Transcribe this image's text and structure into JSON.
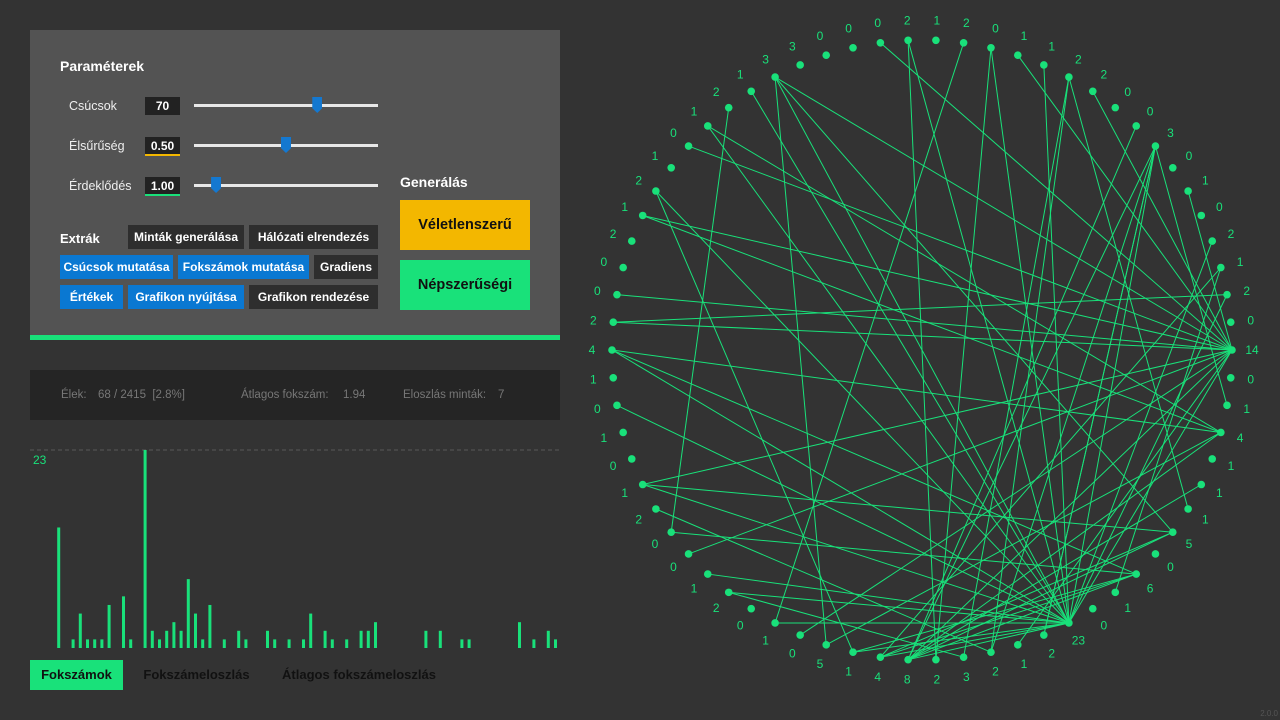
{
  "params": {
    "title": "Paraméterek",
    "sliders": [
      {
        "label": "Csúcsok",
        "value_text": "70",
        "fraction": 0.67
      },
      {
        "label": "Élsűrűség",
        "value_text": "0.50",
        "fraction": 0.5
      },
      {
        "label": "Érdeklődés",
        "value_text": "1.00",
        "fraction": 0.12
      }
    ]
  },
  "extras": {
    "label": "Extrák",
    "buttons": [
      {
        "label": "Minták generálása",
        "active": false
      },
      {
        "label": "Hálózati elrendezés",
        "active": false
      },
      {
        "label": "Csúcsok mutatása",
        "active": true
      },
      {
        "label": "Fokszámok mutatása",
        "active": true
      },
      {
        "label": "Gradiens",
        "active": false
      },
      {
        "label": "Értékek",
        "active": true
      },
      {
        "label": "Grafikon nyújtása",
        "active": true
      },
      {
        "label": "Grafikon rendezése",
        "active": false
      }
    ]
  },
  "generate": {
    "title": "Generálás",
    "random_label": "Véletlenszerű",
    "popular_label": "Népszerűségi",
    "random_color": "#f3b700",
    "popular_color": "#19e17a"
  },
  "stats": {
    "edges_label": "Élek:",
    "edges_value": "68 / 2415  [2.8%]",
    "avg_label": "Átlagos fokszám:",
    "avg_value": "1.94",
    "dist_label": "Eloszlás minták:",
    "dist_value": "7"
  },
  "chart_data": {
    "type": "bar",
    "max_label": "23",
    "ylim": [
      0,
      23
    ],
    "values": [
      0,
      14,
      0,
      1,
      4,
      1,
      1,
      1,
      5,
      0,
      6,
      1,
      0,
      23,
      2,
      1,
      2,
      3,
      2,
      8,
      4,
      1,
      5,
      0,
      1,
      0,
      2,
      1,
      0,
      0,
      2,
      1,
      0,
      1,
      0,
      1,
      4,
      0,
      2,
      1,
      0,
      1,
      0,
      2,
      2,
      3,
      0,
      0,
      0,
      0,
      0,
      0,
      2,
      0,
      2,
      0,
      0,
      1,
      1,
      0,
      0,
      0,
      0,
      0,
      0,
      3,
      0,
      1,
      0,
      2,
      1,
      2,
      0,
      2
    ]
  },
  "tabs": [
    {
      "label": "Fokszámok",
      "active": true
    },
    {
      "label": "Fokszámeloszlás",
      "active": false
    },
    {
      "label": "Átlagos fokszámeloszlás",
      "active": false
    }
  ],
  "graph": {
    "node_color": "#19e17a",
    "degrees": [
      14,
      0,
      1,
      4,
      1,
      1,
      1,
      5,
      0,
      6,
      1,
      0,
      23,
      2,
      1,
      2,
      3,
      2,
      8,
      4,
      1,
      5,
      0,
      1,
      0,
      2,
      1,
      0,
      0,
      2,
      1,
      0,
      1,
      0,
      1,
      4,
      2,
      0,
      0,
      2,
      1,
      2,
      1,
      0,
      1,
      2,
      1,
      3,
      3,
      0,
      0,
      0,
      2,
      1,
      2,
      0,
      1,
      1,
      2,
      2,
      0,
      0,
      3,
      0,
      1,
      0,
      2,
      1,
      2,
      0
    ],
    "edges": [
      [
        0,
        36
      ],
      [
        0,
        37
      ],
      [
        0,
        40
      ],
      [
        0,
        51
      ],
      [
        0,
        56
      ],
      [
        0,
        59
      ],
      [
        0,
        47
      ],
      [
        0,
        30
      ],
      [
        0,
        27
      ],
      [
        0,
        22
      ],
      [
        0,
        18
      ],
      [
        0,
        14
      ],
      [
        0,
        12
      ],
      [
        0,
        64
      ],
      [
        12,
        26
      ],
      [
        12,
        25
      ],
      [
        12,
        23
      ],
      [
        12,
        20
      ],
      [
        12,
        19
      ],
      [
        12,
        18
      ],
      [
        12,
        41
      ],
      [
        12,
        44
      ],
      [
        12,
        46
      ],
      [
        12,
        47
      ],
      [
        12,
        52
      ],
      [
        12,
        55
      ],
      [
        12,
        57
      ],
      [
        12,
        62
      ],
      [
        12,
        66
      ],
      [
        12,
        68
      ],
      [
        12,
        35
      ],
      [
        12,
        33
      ],
      [
        12,
        30
      ],
      [
        3,
        35
      ],
      [
        3,
        40
      ],
      [
        3,
        44
      ],
      [
        3,
        18
      ],
      [
        3,
        21
      ],
      [
        7,
        18
      ],
      [
        7,
        19
      ],
      [
        7,
        47
      ],
      [
        7,
        30
      ],
      [
        9,
        18
      ],
      [
        9,
        19
      ],
      [
        9,
        35
      ],
      [
        9,
        20
      ],
      [
        9,
        28
      ],
      [
        13,
        62
      ],
      [
        13,
        62
      ],
      [
        15,
        62
      ],
      [
        15,
        58
      ],
      [
        15,
        29
      ],
      [
        16,
        58
      ],
      [
        16,
        25
      ],
      [
        17,
        52
      ],
      [
        17,
        55
      ],
      [
        18,
        61
      ],
      [
        18,
        62
      ],
      [
        19,
        67
      ],
      [
        20,
        41
      ],
      [
        21,
        47
      ],
      [
        2,
        62
      ],
      [
        5,
        18
      ],
      [
        6,
        58
      ],
      [
        10,
        67
      ],
      [
        23,
        54
      ],
      [
        28,
        45
      ],
      [
        36,
        68
      ],
      [
        0,
        43
      ]
    ]
  },
  "version": "2.0.0"
}
